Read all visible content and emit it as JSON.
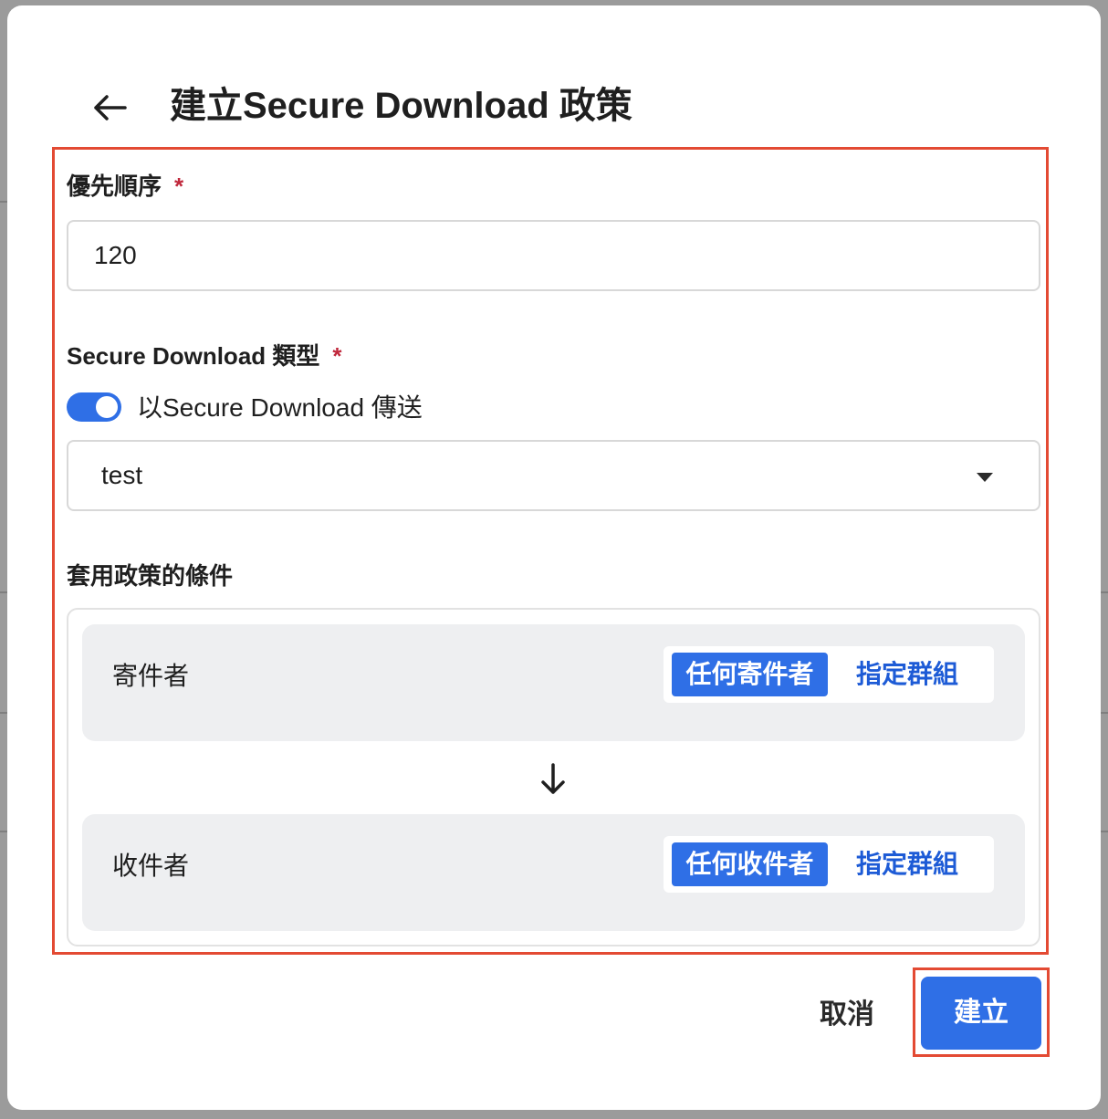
{
  "dialog": {
    "title": "建立Secure Download 政策",
    "back_icon": "arrow-left-icon"
  },
  "priority": {
    "label": "優先順序",
    "required_mark": "*",
    "value": "120"
  },
  "secure_download_type": {
    "label": "Secure Download 類型",
    "required_mark": "*",
    "toggle_label": "以Secure Download 傳送",
    "toggle_on": true,
    "selected": "test"
  },
  "conditions": {
    "label": "套用政策的條件",
    "sender": {
      "label": "寄件者",
      "options": [
        "任何寄件者",
        "指定群組"
      ],
      "selected": "任何寄件者"
    },
    "recipient": {
      "label": "收件者",
      "options": [
        "任何收件者",
        "指定群組"
      ],
      "selected": "任何收件者"
    }
  },
  "footer": {
    "cancel_label": "取消",
    "create_label": "建立"
  },
  "colors": {
    "accent": "#2f6fe6",
    "highlight_border": "#e34a33",
    "required": "#c0283c"
  }
}
